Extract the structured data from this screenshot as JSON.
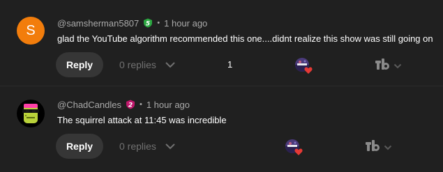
{
  "comments": [
    {
      "avatar_letter": "S",
      "avatar_color": "#f27d0c",
      "author": "@samsherman5807",
      "badge": {
        "icon": "member-badge-icon",
        "glyph": "5",
        "color": "#2ba640"
      },
      "separator": "•",
      "time": "1 hour ago",
      "text": "glad the YouTube algorithm recommended this one....didnt realize this show was still going on",
      "reply_label": "Reply",
      "replies_label": "0 replies",
      "like_count": "1",
      "creator_hearted": true
    },
    {
      "avatar_image": "green-masked-face-avatar",
      "author": "@ChadCandles",
      "badge": {
        "icon": "member-badge-icon",
        "glyph": "2",
        "color": "#c0186c"
      },
      "separator": "•",
      "time": "1 hour ago",
      "text": "The squirrel attack at 11:45 was incredible",
      "reply_label": "Reply",
      "replies_label": "0 replies",
      "like_count": "",
      "creator_hearted": true
    }
  ],
  "icons": {
    "chevron": "chevron-down-icon",
    "heart": "heart-icon",
    "tb": "tubebuddy-icon"
  },
  "colors": {
    "background": "#202020",
    "heart": "#e53935",
    "muted_text": "#aaaaaa",
    "reply_button_bg": "#363636"
  }
}
